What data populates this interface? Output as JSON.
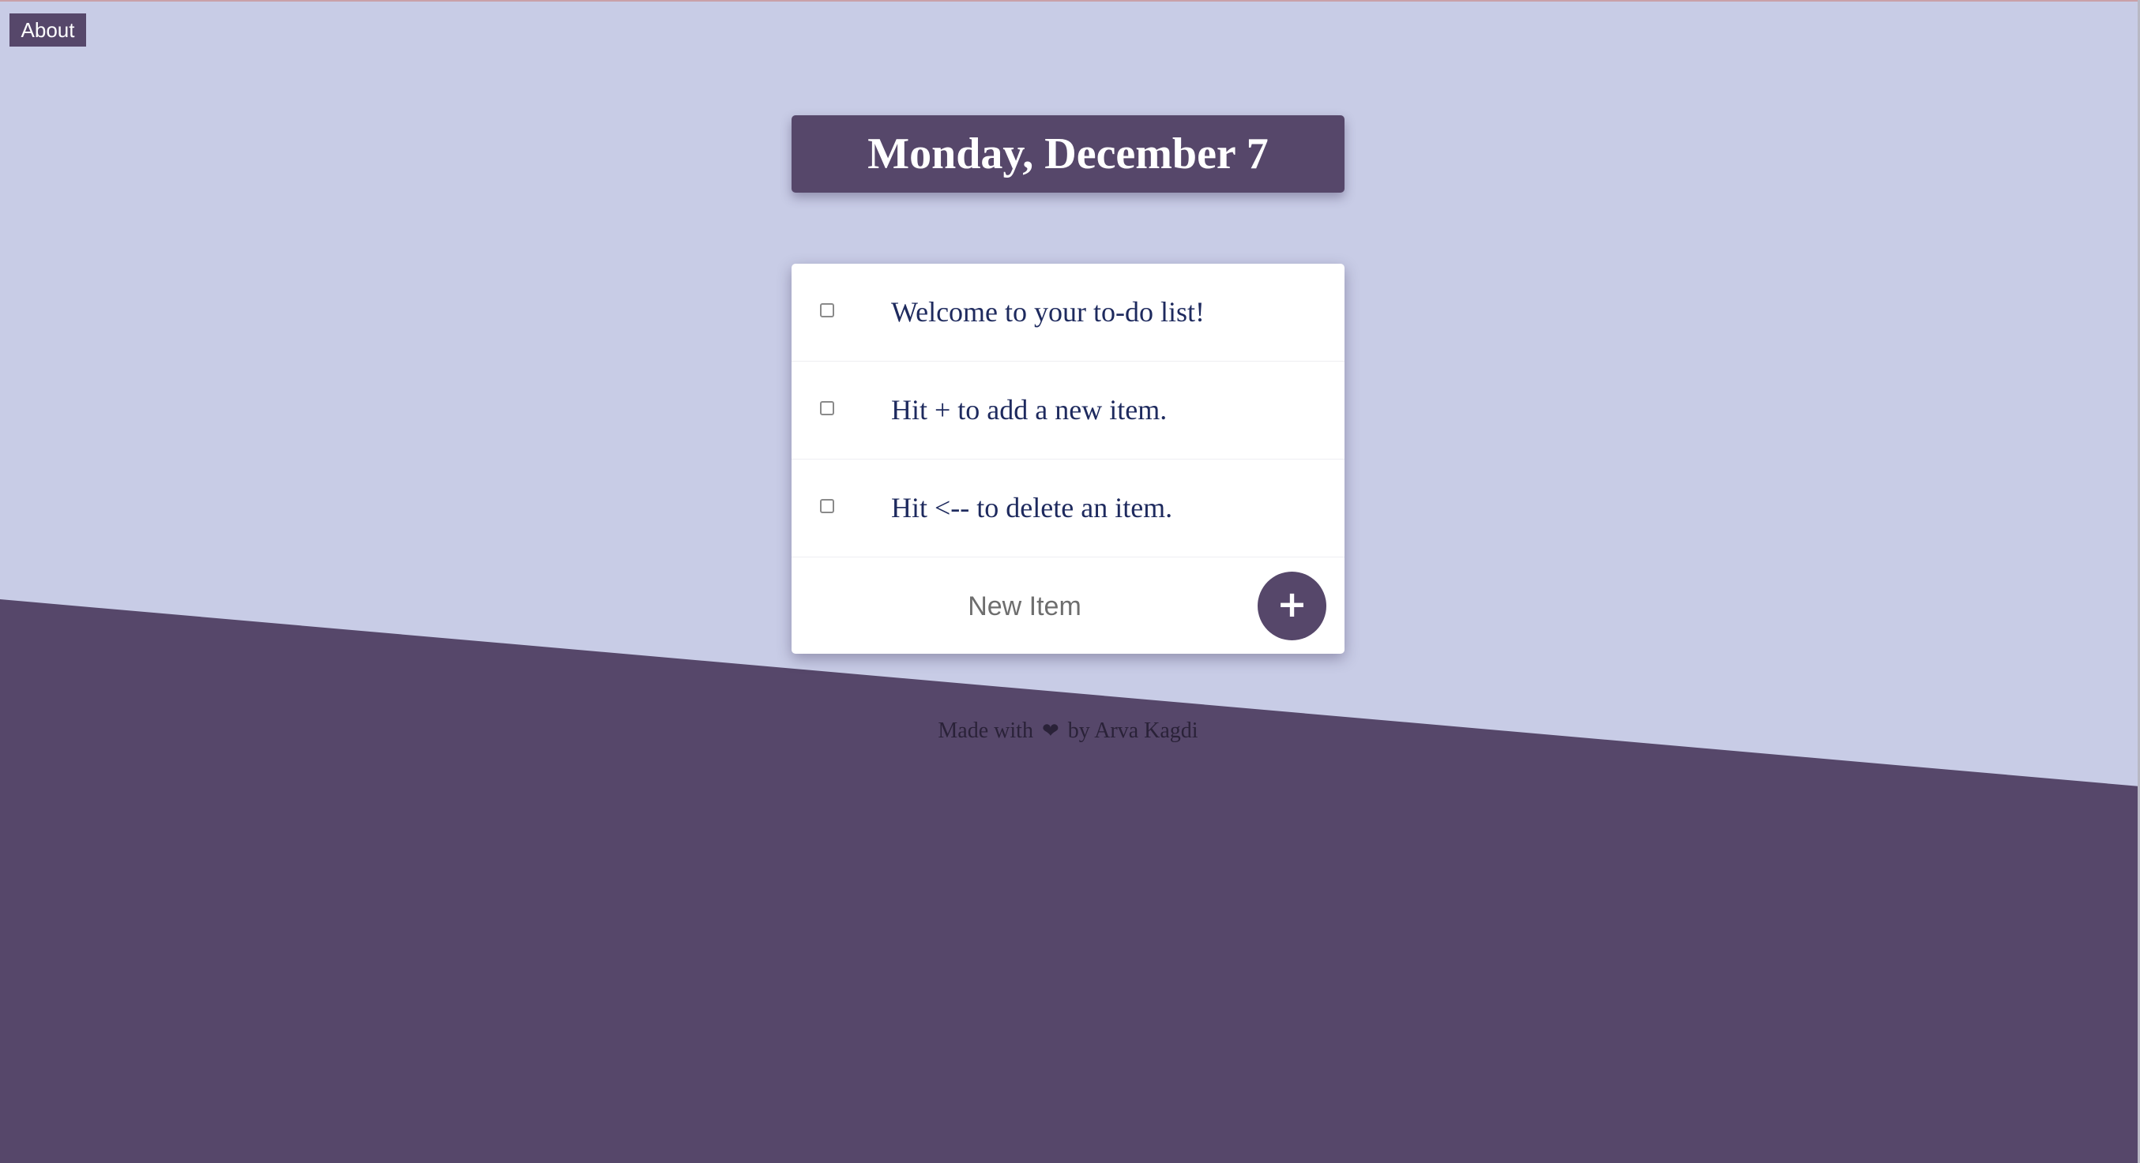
{
  "nav": {
    "about_label": "About"
  },
  "header": {
    "date": "Monday, December 7"
  },
  "todo": {
    "items": [
      {
        "label": "Welcome to your to-do list!",
        "checked": false
      },
      {
        "label": "Hit + to add a new item.",
        "checked": false
      },
      {
        "label": "Hit <-- to delete an item.",
        "checked": false
      }
    ],
    "new_item_placeholder": "New Item",
    "add_button_label": "+"
  },
  "footer": {
    "prefix": "Made with",
    "heart_icon": "heart-icon",
    "suffix": "by Arva Kagdi"
  },
  "colors": {
    "background_light": "#c8cce6",
    "background_dark": "#56476a",
    "item_text": "#1e2a5e"
  }
}
